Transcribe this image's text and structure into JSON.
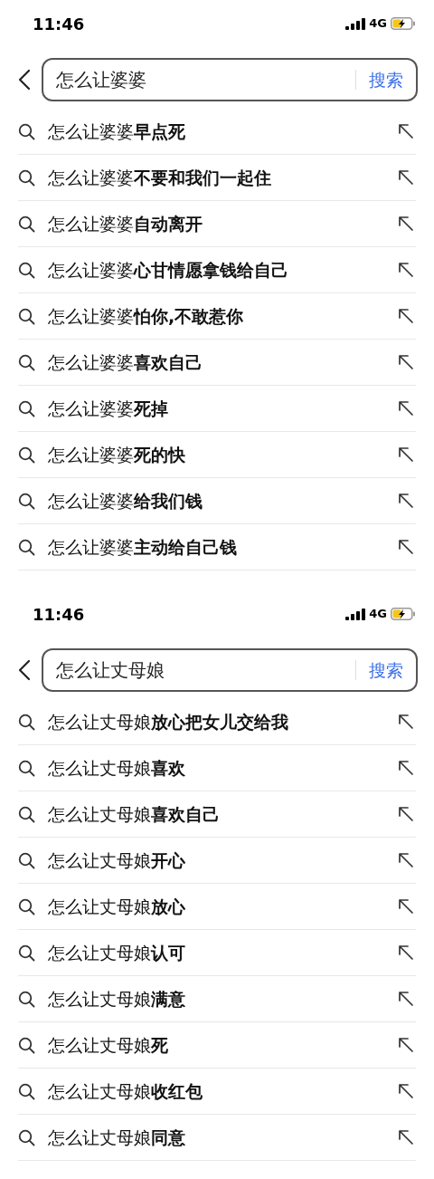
{
  "panels": [
    {
      "status_bar": {
        "time": "11:46",
        "network": "4G"
      },
      "search": {
        "value": "怎么让婆婆",
        "button": "搜索"
      },
      "suggestions": [
        "怎么让婆婆**早点死**",
        "怎么让婆婆**不要和我们一起住**",
        "怎么让婆婆**自动离开**",
        "怎么让婆婆**心甘情愿拿钱给自己**",
        "怎么让婆婆**怕你,不敢惹你**",
        "怎么让婆婆**喜欢自己**",
        "怎么让婆婆**死掉**",
        "怎么让婆婆**死的快**",
        "怎么让婆婆**给我们钱**",
        "怎么让婆婆**主动给自己钱**"
      ]
    },
    {
      "status_bar": {
        "time": "11:46",
        "network": "4G"
      },
      "search": {
        "value": "怎么让丈母娘",
        "button": "搜索"
      },
      "suggestions": [
        "怎么让丈母娘**放心把女儿交给我**",
        "怎么让丈母娘**喜欢**",
        "怎么让丈母娘**喜欢自己**",
        "怎么让丈母娘**开心**",
        "怎么让丈母娘**放心**",
        "怎么让丈母娘**认可**",
        "怎么让丈母娘**满意**",
        "怎么让丈母娘**死**",
        "怎么让丈母娘**收红包**",
        "怎么让丈母娘**同意**"
      ]
    }
  ]
}
